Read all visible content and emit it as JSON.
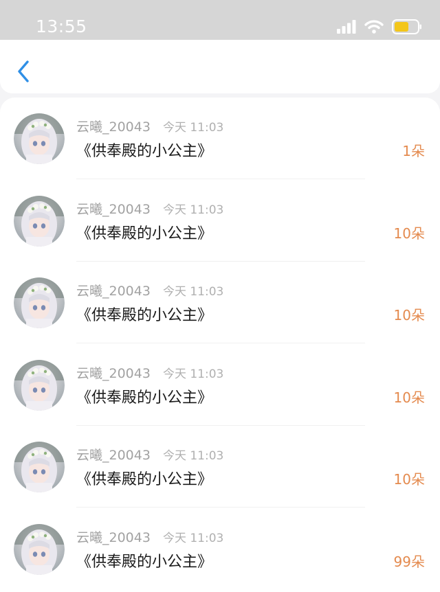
{
  "status_bar": {
    "time": "13:55",
    "icons": [
      "signal-icon",
      "wifi-icon",
      "battery-icon"
    ],
    "battery_color": "#f3c61b"
  },
  "nav": {
    "back_icon": "chevron-left-icon",
    "accent_color": "#2f8fe6"
  },
  "colors": {
    "amount": "#e48a4e"
  },
  "rows": [
    {
      "username": "云曦_20043",
      "time": "今天 11:03",
      "title": "《供奉殿的小公主》",
      "amount": "1朵"
    },
    {
      "username": "云曦_20043",
      "time": "今天 11:03",
      "title": "《供奉殿的小公主》",
      "amount": "10朵"
    },
    {
      "username": "云曦_20043",
      "time": "今天 11:03",
      "title": "《供奉殿的小公主》",
      "amount": "10朵"
    },
    {
      "username": "云曦_20043",
      "time": "今天 11:03",
      "title": "《供奉殿的小公主》",
      "amount": "10朵"
    },
    {
      "username": "云曦_20043",
      "time": "今天 11:03",
      "title": "《供奉殿的小公主》",
      "amount": "10朵"
    },
    {
      "username": "云曦_20043",
      "time": "今天 11:03",
      "title": "《供奉殿的小公主》",
      "amount": "99朵"
    }
  ]
}
